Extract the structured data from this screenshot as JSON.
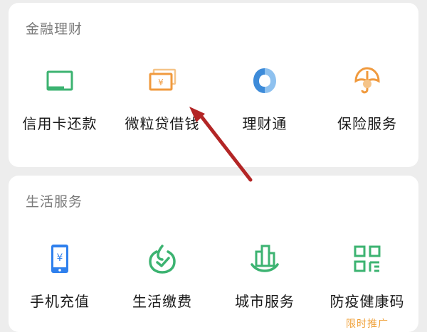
{
  "finance": {
    "title": "金融理财",
    "items": [
      {
        "label": "信用卡还款",
        "icon": "credit-card-icon",
        "color": "#3cb371"
      },
      {
        "label": "微粒贷借钱",
        "icon": "banknote-icon",
        "color": "#f09a3e"
      },
      {
        "label": "理财通",
        "icon": "wealth-icon",
        "color": "#3d8bd9"
      },
      {
        "label": "保险服务",
        "icon": "umbrella-icon",
        "color": "#f09a3e"
      }
    ]
  },
  "life": {
    "title": "生活服务",
    "items": [
      {
        "label": "手机充值",
        "icon": "phone-recharge-icon",
        "color": "#2f80ed"
      },
      {
        "label": "生活缴费",
        "icon": "bill-pay-icon",
        "color": "#3cb371"
      },
      {
        "label": "城市服务",
        "icon": "city-icon",
        "color": "#3cb371"
      },
      {
        "label": "防疫健康码",
        "icon": "qr-code-icon",
        "color": "#3cb371",
        "promo": "限时推广"
      }
    ]
  },
  "annotation": {
    "color": "#b32525"
  }
}
